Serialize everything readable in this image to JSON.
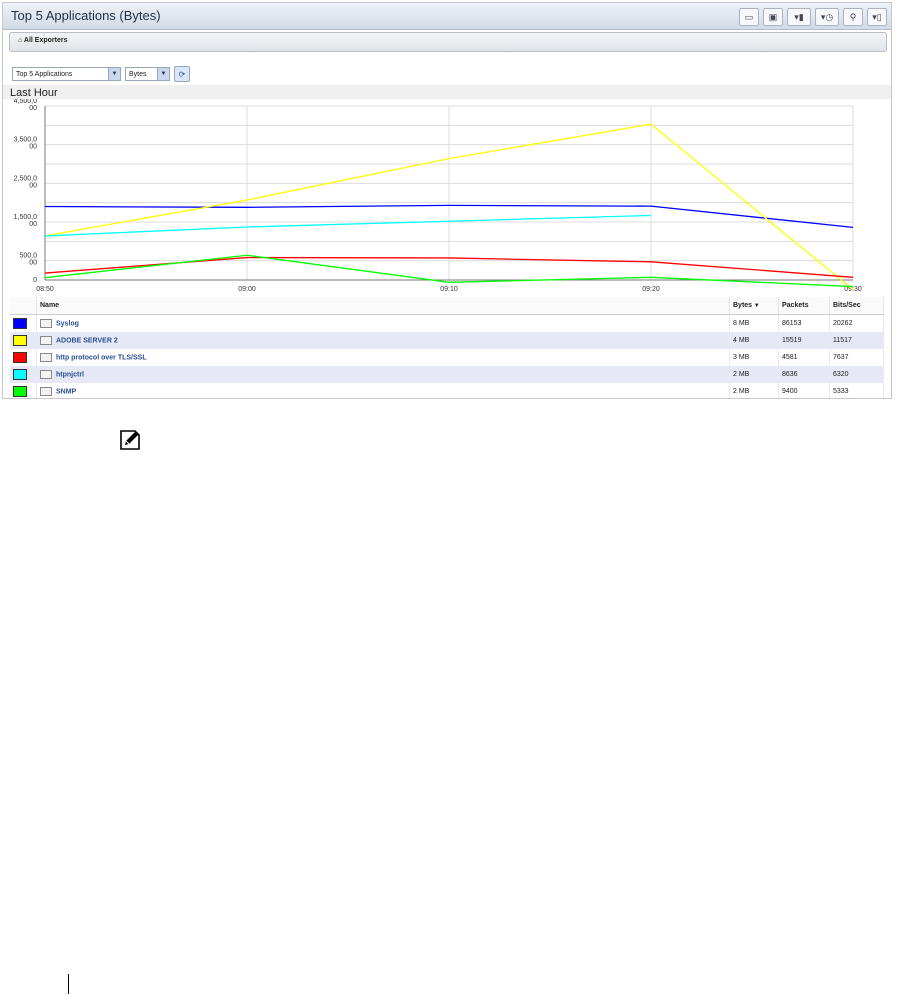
{
  "window": {
    "title": "Top 5 Applications (Bytes)"
  },
  "toolbar": {
    "icons": [
      "page-icon",
      "save-icon",
      "chart-icon",
      "history-icon",
      "zoom-icon",
      "export-icon"
    ]
  },
  "breadcrumb": {
    "label": "All Exporters"
  },
  "selectors": {
    "report": "Top 5 Applications",
    "metric": "Bytes"
  },
  "chart_header": {
    "label": "Last Hour"
  },
  "chart_data": {
    "type": "line",
    "x": [
      "08:50",
      "09:00",
      "09:10",
      "09:20",
      "09:30"
    ],
    "y_ticks": [
      "4,500,000",
      "3,500,000",
      "2,500,000",
      "1,500,000",
      "500,000",
      "0"
    ],
    "ylim": [
      0,
      4500000
    ],
    "grid": true,
    "series": [
      {
        "name": "Syslog",
        "color": "#0000ff",
        "values": [
          1900000,
          1880000,
          1930000,
          1910000,
          1360000
        ]
      },
      {
        "name": "ADOBE SERVER 2",
        "color": "#ffff00",
        "values": [
          1140000,
          2070000,
          3140000,
          4030000,
          -250000
        ]
      },
      {
        "name": "http protocol over TLS/SSL",
        "color": "#ff0000",
        "values": [
          180000,
          580000,
          570000,
          470000,
          70000
        ]
      },
      {
        "name": "htpnjctrl",
        "color": "#00ffff",
        "values": [
          1140000,
          1370000,
          1520000,
          1670000,
          null
        ]
      },
      {
        "name": "SNMP",
        "color": "#00ff00",
        "values": [
          60000,
          640000,
          -60000,
          70000,
          -170000
        ]
      }
    ]
  },
  "table": {
    "columns": {
      "name": "Name",
      "bytes": "Bytes",
      "packets": "Packets",
      "bits": "Bits/Sec"
    },
    "rows": [
      {
        "name": "Syslog",
        "color": "#0000ff",
        "bytes": "8 MB",
        "packets": "86153",
        "bits": "20262"
      },
      {
        "name": "ADOBE SERVER 2",
        "color": "#ffff00",
        "bytes": "4 MB",
        "packets": "15519",
        "bits": "11517"
      },
      {
        "name": "http protocol over TLS/SSL",
        "color": "#ff0000",
        "bytes": "3 MB",
        "packets": "4581",
        "bits": "7637"
      },
      {
        "name": "htpnjctrl",
        "color": "#00ffff",
        "bytes": "2 MB",
        "packets": "8636",
        "bits": "6320"
      },
      {
        "name": "SNMP",
        "color": "#00ff00",
        "bytes": "2 MB",
        "packets": "9400",
        "bits": "5333"
      }
    ]
  },
  "note": {
    "icon": "pencil-note-icon"
  }
}
